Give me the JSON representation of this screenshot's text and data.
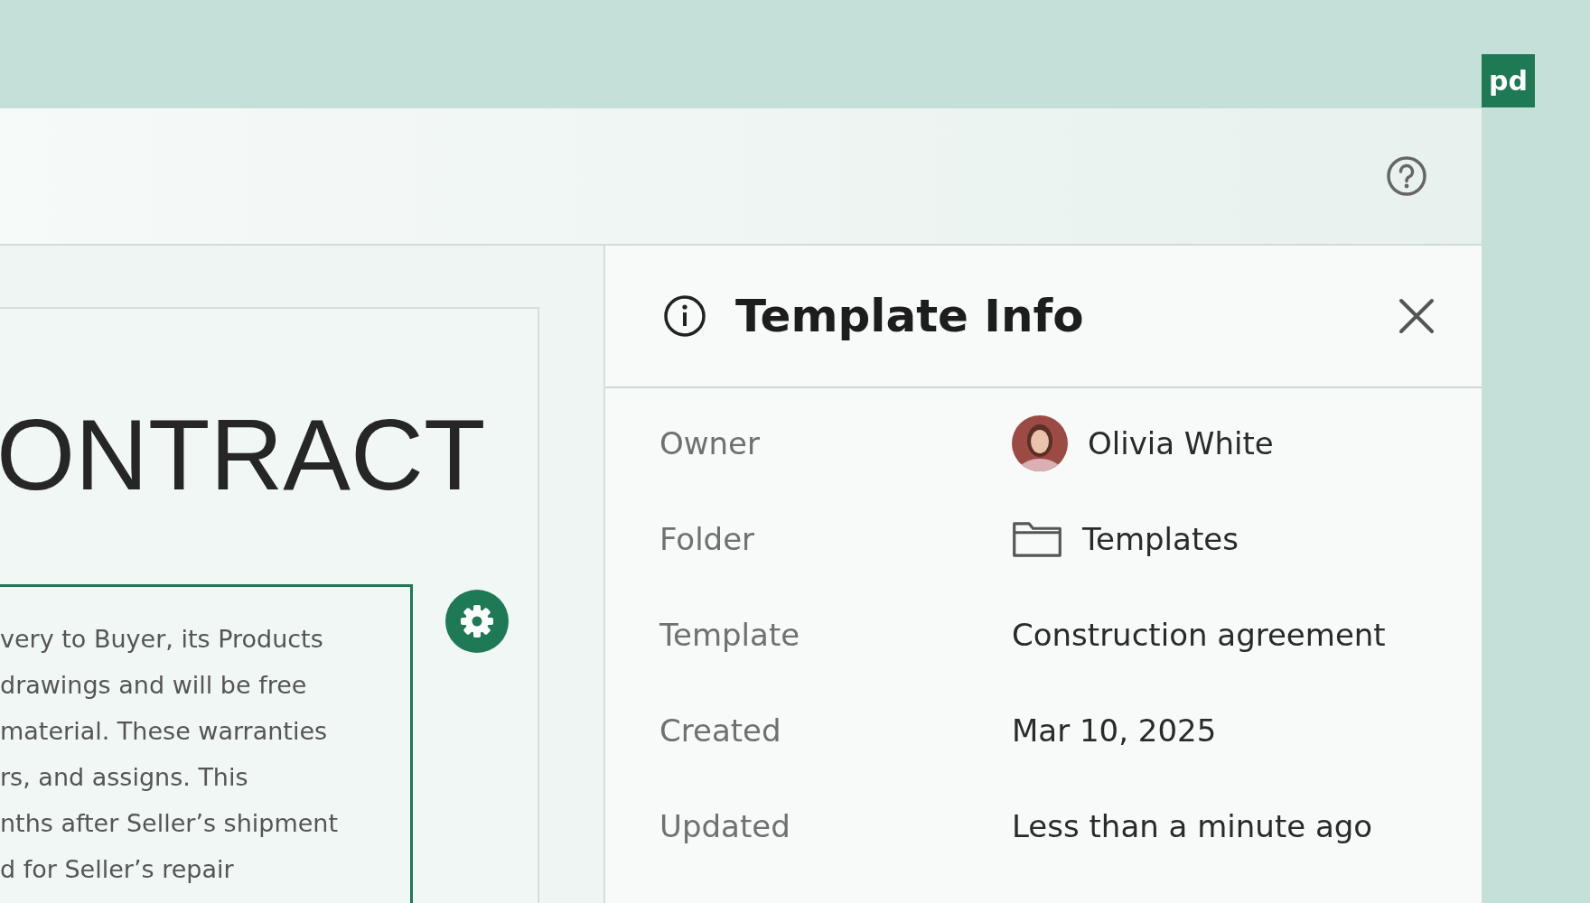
{
  "logo": {
    "text": "pd"
  },
  "document": {
    "title": "ONTRACT",
    "lines": [
      "very to Buyer, its Products",
      "drawings and will be free",
      "material. These warranties",
      "rs, and assigns. This",
      "nths after Seller’s shipment",
      "d for Seller’s repair"
    ]
  },
  "panel": {
    "title": "Template Info",
    "rows": [
      {
        "label": "Owner",
        "value": "Olivia White",
        "kind": "avatar"
      },
      {
        "label": "Folder",
        "value": "Templates",
        "kind": "folder"
      },
      {
        "label": "Template",
        "value": "Construction agreement",
        "kind": "text"
      },
      {
        "label": "Created",
        "value": "Mar 10, 2025",
        "kind": "text"
      },
      {
        "label": "Updated",
        "value": "Less than a minute ago",
        "kind": "text"
      }
    ]
  }
}
